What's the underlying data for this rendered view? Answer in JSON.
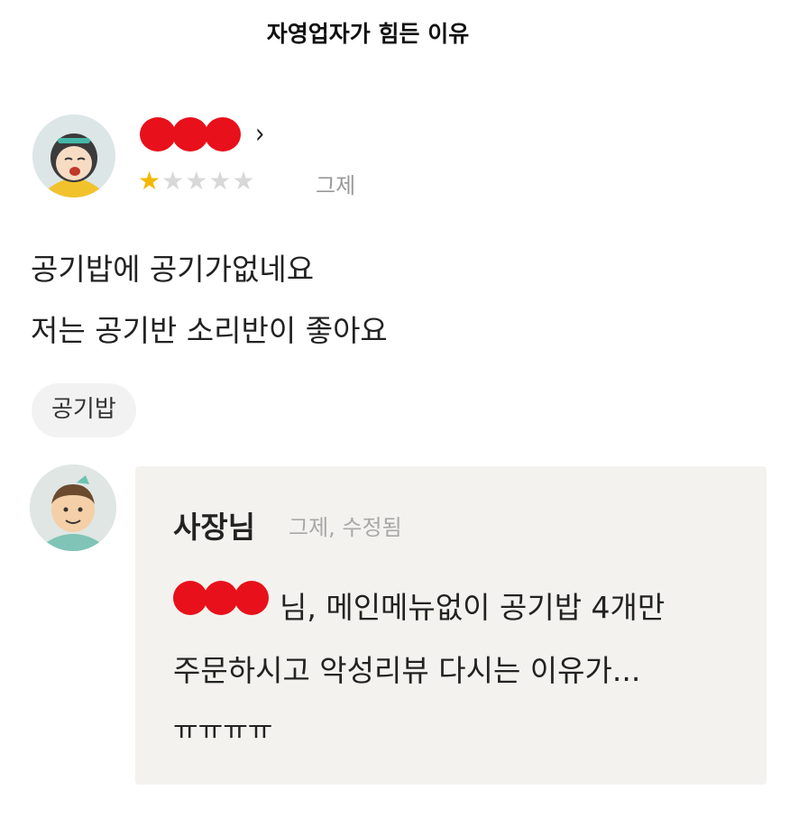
{
  "post": {
    "title": "자영업자가 힘든 이유"
  },
  "review": {
    "chevron": "›",
    "rating": 1,
    "max_rating": 5,
    "star_glyph": "★",
    "date": "그제",
    "lines": [
      "공기밥에 공기가없네요",
      "저는 공기반 소리반이 좋아요"
    ],
    "menu_tag": "공기밥"
  },
  "reply": {
    "author": "사장님",
    "date": "그제, 수정됨",
    "lines": [
      "님, 메인메뉴없이 공기밥 4개만",
      "주문하시고 악성리뷰 다시는 이유가...",
      "ㅠㅠㅠㅠ"
    ]
  },
  "colors": {
    "star_on": "#f5b700",
    "star_off": "#d8d8d8",
    "redaction": "#e8101a",
    "reply_bg": "#f3f2ee",
    "tag_bg": "#f2f2f2"
  },
  "icons": {
    "reviewer_avatar": "cartoon-face-avatar-icon",
    "owner_avatar": "cartoon-chef-avatar-icon",
    "chevron": "chevron-right-icon",
    "stars": "star-icon"
  }
}
